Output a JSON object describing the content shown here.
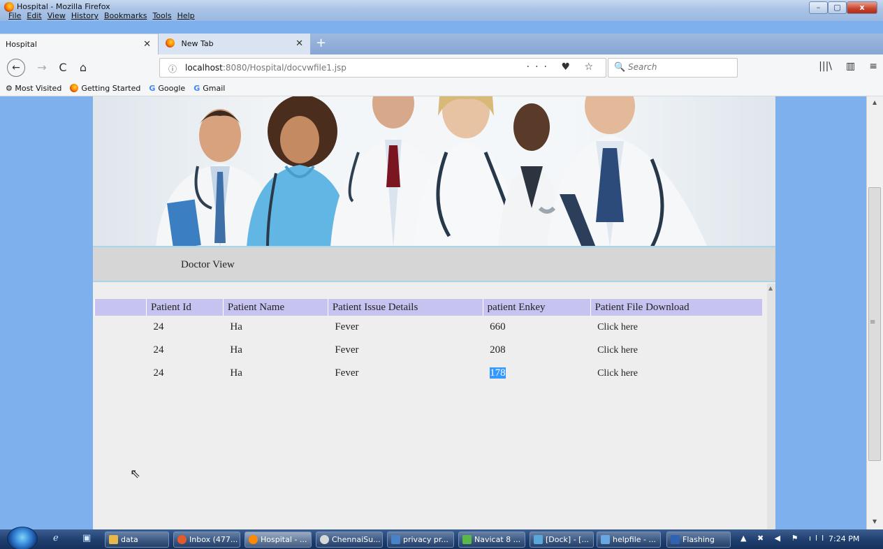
{
  "window": {
    "title": "Hospital - Mozilla Firefox",
    "menu": [
      "File",
      "Edit",
      "View",
      "History",
      "Bookmarks",
      "Tools",
      "Help"
    ],
    "controls": {
      "minimize": "–",
      "maximize": "▢",
      "close": "x"
    }
  },
  "tabs": [
    {
      "label": "Hospital",
      "close": "✕"
    },
    {
      "label": "New Tab",
      "close": "✕"
    }
  ],
  "newtab_label": "+",
  "nav": {
    "back": "←",
    "forward": "→",
    "reload": "C",
    "home": "⌂",
    "url_host": "localhost",
    "url_rest": ":8080/Hospital/docvwfile1.jsp",
    "info_icon": "ⓘ",
    "page_actions": "···  ♥  ☆",
    "search_placeholder": "Search",
    "search_icon": "🔍",
    "tools": [
      "|||\\",
      "▥",
      "≡"
    ]
  },
  "bookmarks": [
    {
      "label": "Most Visited",
      "icon": "gear-icon"
    },
    {
      "label": "Getting Started",
      "icon": "firefox-icon"
    },
    {
      "label": "Google",
      "icon": "google-g-icon"
    },
    {
      "label": "Gmail",
      "icon": "google-g-icon"
    }
  ],
  "page": {
    "section_label": "Doctor View",
    "table": {
      "headers": [
        "",
        "Patient Id",
        "Patient Name",
        "Patient Issue Details",
        "patient Enkey",
        "Patient File Download"
      ],
      "rows": [
        {
          "id": "24",
          "name": "Ha",
          "issue": "Fever",
          "enkey": "660",
          "download": "Click here"
        },
        {
          "id": "24",
          "name": "Ha",
          "issue": "Fever",
          "enkey": "208",
          "download": "Click here"
        },
        {
          "id": "24",
          "name": "Ha",
          "issue": "Fever",
          "enkey": "178",
          "download": "Click here"
        }
      ]
    }
  },
  "taskbar": {
    "items": [
      {
        "label": "data",
        "color": "#e8b84a"
      },
      {
        "label": "Inbox (477...",
        "color": "#e35a2b"
      },
      {
        "label": "Hospital - ...",
        "color": "#ff8a00"
      },
      {
        "label": "ChennaiSu...",
        "color": "#d7d7d7"
      },
      {
        "label": "privacy pr...",
        "color": "#4a82c9"
      },
      {
        "label": "Navicat 8 ...",
        "color": "#58b84a"
      },
      {
        "label": "[Dock] - [...",
        "color": "#5aa7d9"
      },
      {
        "label": "helpfile - ...",
        "color": "#6aa6e0"
      },
      {
        "label": "Flashing",
        "color": "#2f62b1"
      }
    ],
    "clock": "7:24 PM"
  }
}
